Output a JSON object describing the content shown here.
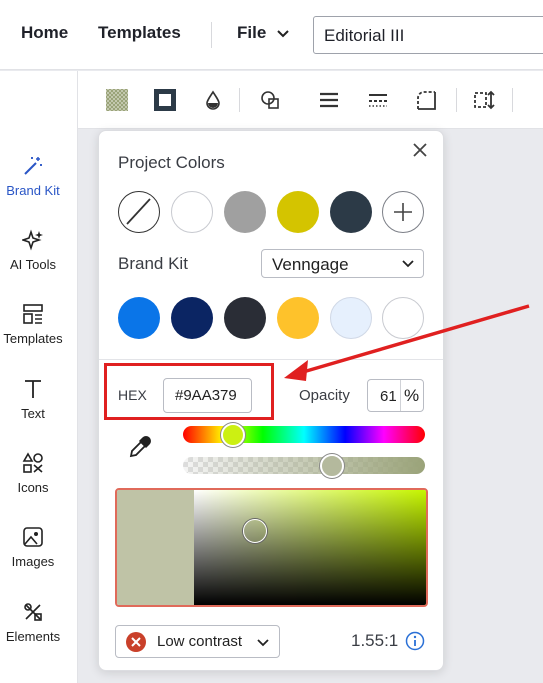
{
  "topbar": {
    "home": "Home",
    "templates": "Templates",
    "file": "File",
    "doc_title": "Editorial III"
  },
  "toolbar": {
    "icons": [
      "fill-pattern-icon",
      "border-icon",
      "opacity-drop-icon",
      "shapes-icon",
      "align-icon",
      "line-style-icon",
      "corner-icon",
      "resize-icon"
    ]
  },
  "sidebar": {
    "items": [
      {
        "label": "Brand Kit",
        "icon": "magic-wand-icon"
      },
      {
        "label": "AI Tools",
        "icon": "sparkles-icon"
      },
      {
        "label": "Templates",
        "icon": "templates-icon"
      },
      {
        "label": "Text",
        "icon": "text-icon"
      },
      {
        "label": "Icons",
        "icon": "icons-icon"
      },
      {
        "label": "Images",
        "icon": "images-icon"
      },
      {
        "label": "Elements",
        "icon": "elements-icon"
      }
    ]
  },
  "color_popup": {
    "project_colors_title": "Project Colors",
    "project_colors": [
      "none",
      "#ffffff",
      "#a0a0a0",
      "#d4c400",
      "#2c3a47"
    ],
    "brand_kit_title": "Brand Kit",
    "brand_kit_select": "Venngage",
    "brand_colors": [
      "#0a75e8",
      "#0b2563",
      "#2a2d36",
      "#fec22b",
      "#e6f0fd",
      "#ffffff"
    ],
    "hex_label": "HEX",
    "hex_value": "#9AA379",
    "opacity_label": "Opacity",
    "opacity_value": "61",
    "opacity_unit": "%",
    "hue_position": 0.2,
    "alpha_position": 0.61,
    "current_color": "#9AA379",
    "contrast_label": "Low contrast",
    "contrast_ratio": "1.55:1"
  },
  "colors": {
    "accent_blue": "#2a56c6",
    "annotation_red": "#e02020"
  }
}
